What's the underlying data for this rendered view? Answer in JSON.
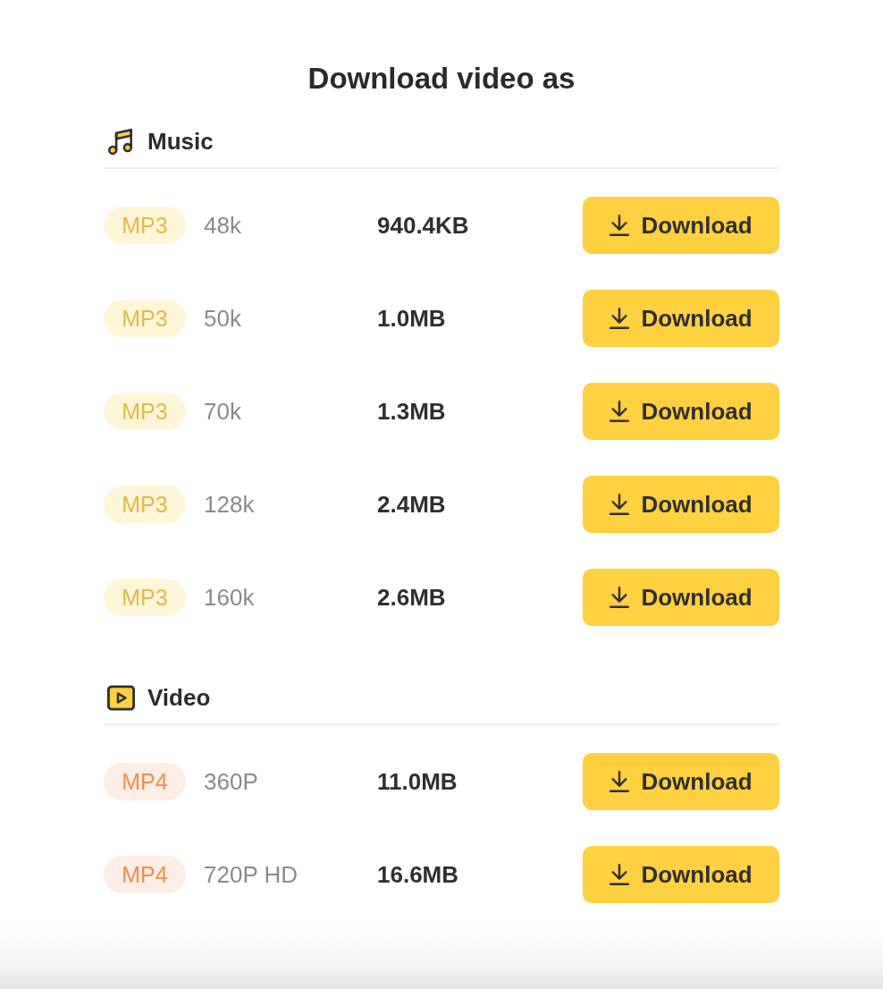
{
  "title": "Download video as",
  "sections": [
    {
      "kind": "music",
      "heading": "Music",
      "items": [
        {
          "format": "MP3",
          "quality": "48k",
          "size": "940.4KB",
          "button": "Download"
        },
        {
          "format": "MP3",
          "quality": "50k",
          "size": "1.0MB",
          "button": "Download"
        },
        {
          "format": "MP3",
          "quality": "70k",
          "size": "1.3MB",
          "button": "Download"
        },
        {
          "format": "MP3",
          "quality": "128k",
          "size": "2.4MB",
          "button": "Download"
        },
        {
          "format": "MP3",
          "quality": "160k",
          "size": "2.6MB",
          "button": "Download"
        }
      ]
    },
    {
      "kind": "video",
      "heading": "Video",
      "items": [
        {
          "format": "MP4",
          "quality": "360P",
          "size": "11.0MB",
          "button": "Download"
        },
        {
          "format": "MP4",
          "quality": "720P HD",
          "size": "16.6MB",
          "button": "Download"
        }
      ]
    }
  ]
}
